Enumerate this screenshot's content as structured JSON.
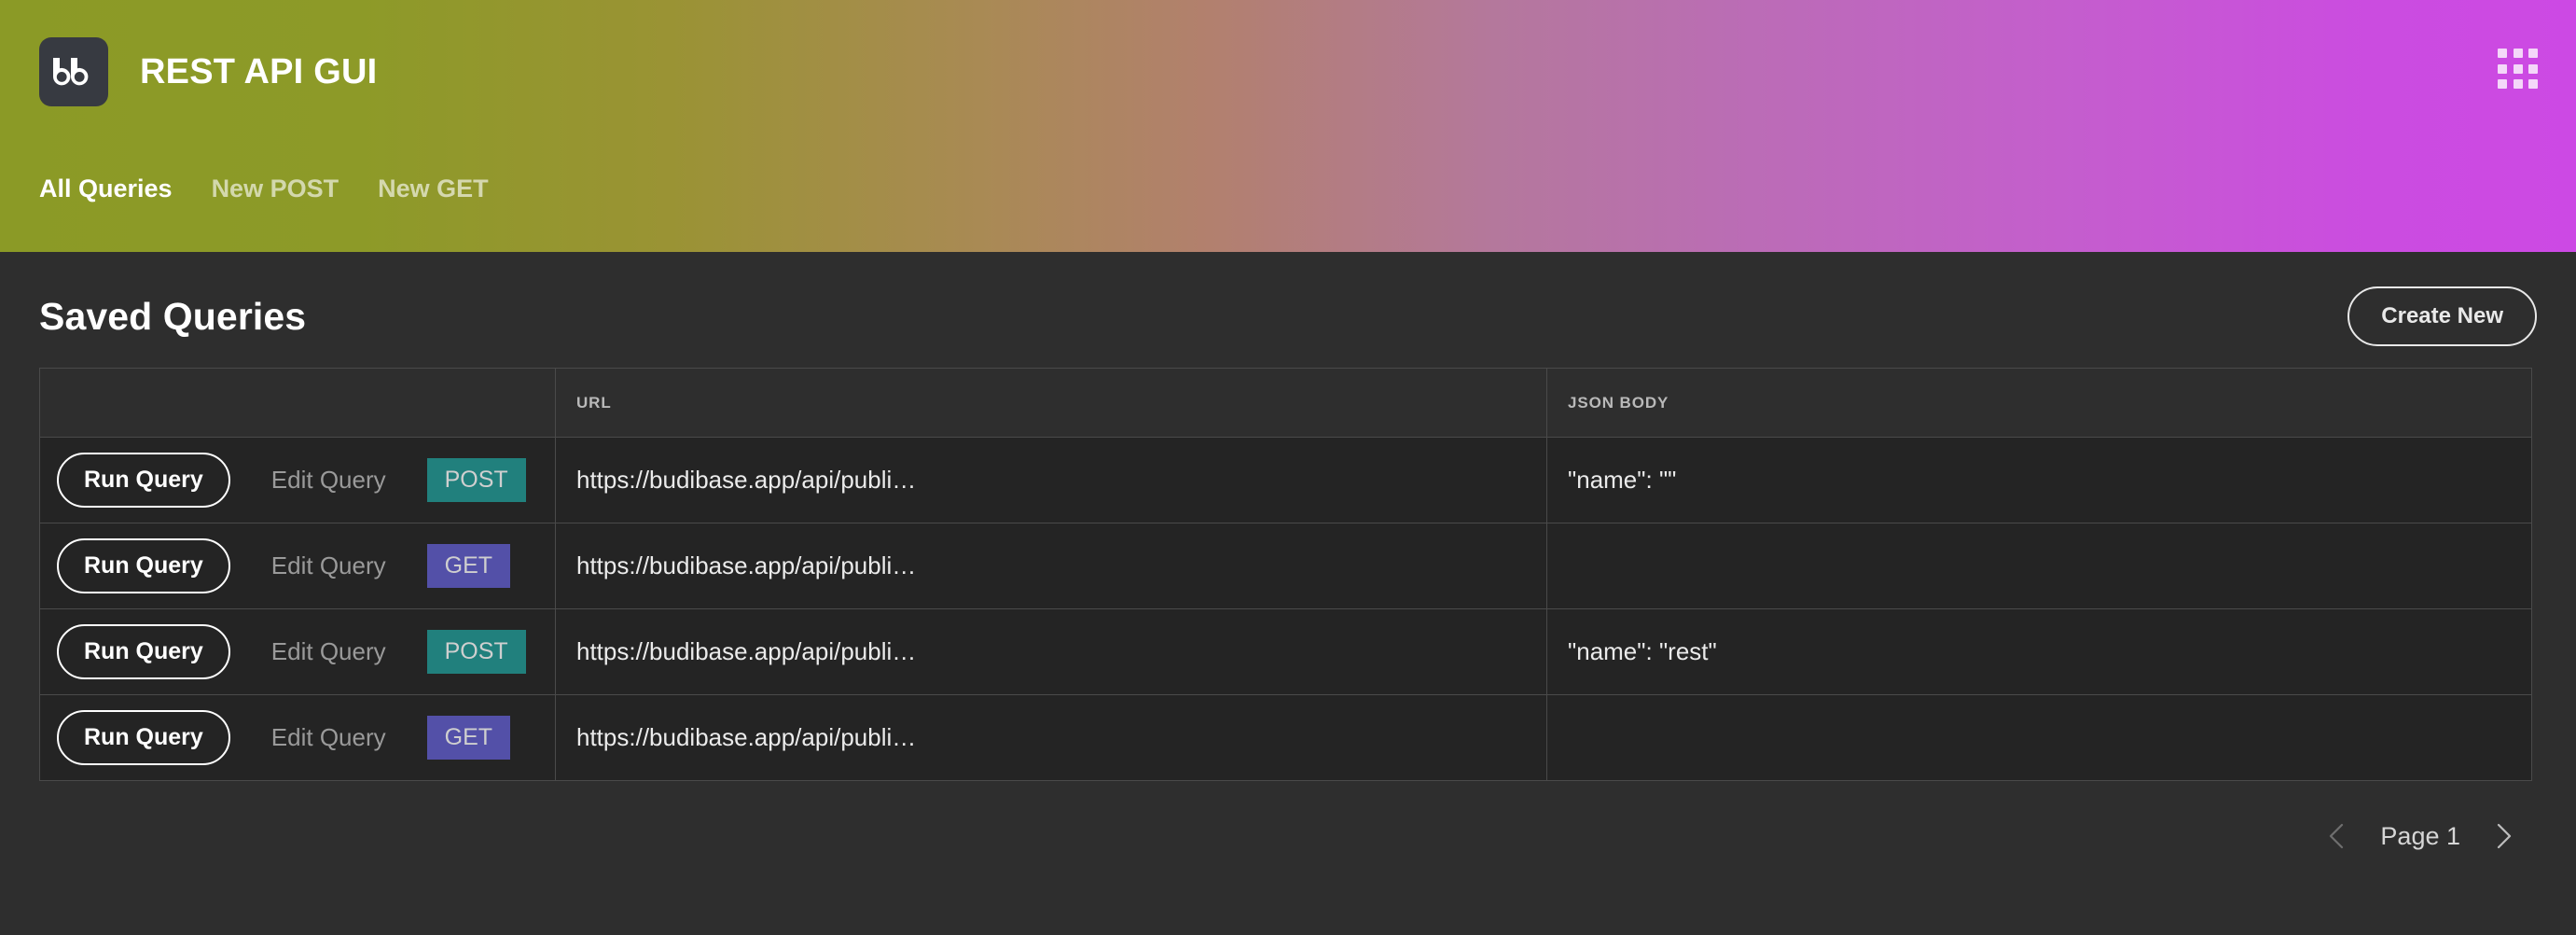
{
  "header": {
    "logo_text": "bb",
    "title": "REST API GUI",
    "apps_icon": "grid-icon",
    "gradient_start": "#8b9a26",
    "gradient_end": "#cc49e4",
    "nav": [
      {
        "label": "All Queries",
        "active": true
      },
      {
        "label": "New POST",
        "active": false
      },
      {
        "label": "New GET",
        "active": false
      }
    ]
  },
  "main": {
    "page_title": "Saved Queries",
    "create_button": "Create New",
    "table": {
      "columns": [
        "",
        "URL",
        "JSON BODY"
      ],
      "rows": [
        {
          "run_label": "Run Query",
          "edit_label": "Edit Query",
          "method": "POST",
          "url": "https://budibase.app/api/publi…",
          "json_body": "\"name\": \"\""
        },
        {
          "run_label": "Run Query",
          "edit_label": "Edit Query",
          "method": "GET",
          "url": "https://budibase.app/api/publi…",
          "json_body": ""
        },
        {
          "run_label": "Run Query",
          "edit_label": "Edit Query",
          "method": "POST",
          "url": "https://budibase.app/api/publi…",
          "json_body": "\"name\": \"rest\""
        },
        {
          "run_label": "Run Query",
          "edit_label": "Edit Query",
          "method": "GET",
          "url": "https://budibase.app/api/publi…",
          "json_body": ""
        }
      ]
    },
    "pagination": {
      "prev_icon": "chevron-left-icon",
      "next_icon": "chevron-right-icon",
      "page_label": "Page 1"
    }
  },
  "colors": {
    "post_badge": "#21807d",
    "get_badge": "#5350a8",
    "page_background": "#2e2e2e",
    "row_background": "#242424",
    "border": "#4a4a4a"
  }
}
